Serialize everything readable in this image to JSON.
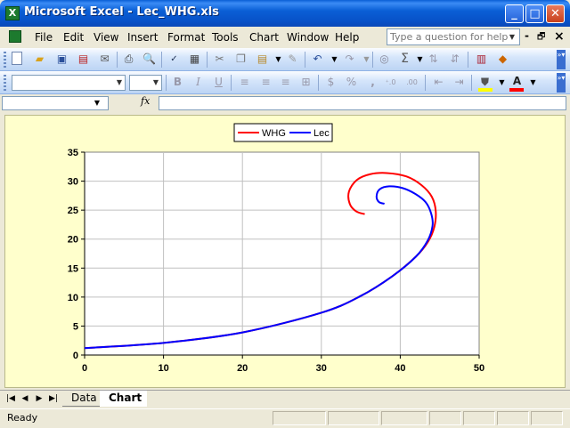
{
  "window": {
    "title": "Microsoft Excel - Lec_WHG.xls",
    "app_icon_glyph": "X",
    "min_glyph": "_",
    "max_glyph": "□",
    "close_glyph": "✕"
  },
  "menu": {
    "items": [
      "File",
      "Edit",
      "View",
      "Insert",
      "Format",
      "Tools",
      "Chart",
      "Window",
      "Help"
    ],
    "help_placeholder": "Type a question for help",
    "min_glyph": "-",
    "restore_glyph": "🗗",
    "close_glyph": "×"
  },
  "formula_bar": {
    "fx_label": "fx",
    "name_value": "",
    "formula_value": ""
  },
  "sheets": {
    "tabs": [
      "Data",
      "Chart"
    ],
    "active": "Chart"
  },
  "status": {
    "text": "Ready"
  },
  "colors": {
    "whg": "#ff0000",
    "lec": "#0000ff",
    "chart_bg": "#ffffcc",
    "plot_bg": "#ffffff"
  },
  "chart_data": {
    "type": "scatter",
    "title": "",
    "xlabel": "",
    "ylabel": "",
    "xlim": [
      0,
      50
    ],
    "ylim": [
      0,
      35
    ],
    "x_ticks": [
      0,
      10,
      20,
      30,
      40,
      50
    ],
    "y_ticks": [
      0,
      5,
      10,
      15,
      20,
      25,
      30,
      35
    ],
    "grid": true,
    "legend_position": "top",
    "series": [
      {
        "name": "WHG",
        "color": "#ff0000",
        "x": [
          0,
          10,
          20,
          30,
          35,
          39,
          42,
          43.5,
          44.3,
          44.5,
          44.0,
          42.7,
          40.8,
          38.3,
          36.2,
          34.5,
          33.5,
          33.6,
          34.4,
          35.5
        ],
        "y": [
          1.2,
          2.1,
          3.9,
          7.3,
          10.2,
          13.6,
          17.0,
          19.5,
          22.0,
          24.8,
          27.3,
          29.3,
          30.8,
          31.4,
          31.2,
          30.2,
          28.2,
          26.1,
          24.8,
          24.3
        ]
      },
      {
        "name": "Lec",
        "color": "#0000ff",
        "x": [
          0,
          10,
          20,
          30,
          35,
          39,
          42,
          43.5,
          44.1,
          43.9,
          43.2,
          41.9,
          40.3,
          38.6,
          37.4,
          37.0,
          37.3,
          38.0
        ],
        "y": [
          1.2,
          2.1,
          3.9,
          7.3,
          10.2,
          13.6,
          17.0,
          19.8,
          22.4,
          24.5,
          26.4,
          27.8,
          28.8,
          29.1,
          28.6,
          27.4,
          26.4,
          26.1
        ]
      }
    ]
  }
}
